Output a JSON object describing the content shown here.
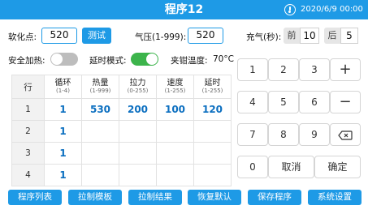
{
  "header": {
    "title": "程序12",
    "datetime": "2020/6/9  00:00",
    "icon": "thermometer-icon"
  },
  "params": {
    "softening_label": "软化点:",
    "softening_value": "520",
    "test_button": "测试",
    "pressure_label": "气压(1-999):",
    "pressure_value": "520",
    "inflate_label": "充气(秒):",
    "inflate_front_label": "前",
    "inflate_front_value": "10",
    "inflate_back_label": "后",
    "inflate_back_value": "5"
  },
  "options": {
    "safety_heat_label": "安全加热:",
    "safety_heat_on": false,
    "delay_mode_label": "延时模式:",
    "delay_mode_on": true,
    "clamp_temp_label": "夹钳温度:",
    "clamp_temp_value": "70°C"
  },
  "table": {
    "row_header": "行",
    "columns": [
      {
        "name": "循环",
        "range": "(1-4)"
      },
      {
        "name": "热量",
        "range": "(1-999)"
      },
      {
        "name": "拉力",
        "range": "(0-255)"
      },
      {
        "name": "速度",
        "range": "(1-255)"
      },
      {
        "name": "延时",
        "range": "(1-255)"
      }
    ],
    "rows": [
      {
        "index": "1",
        "cells": [
          "1",
          "530",
          "200",
          "100",
          "120"
        ]
      },
      {
        "index": "2",
        "cells": [
          "1",
          "",
          "",
          "",
          ""
        ]
      },
      {
        "index": "3",
        "cells": [
          "1",
          "",
          "",
          "",
          ""
        ]
      },
      {
        "index": "4",
        "cells": [
          "1",
          "",
          "",
          "",
          ""
        ]
      }
    ]
  },
  "keypad": {
    "keys": [
      "1",
      "2",
      "3",
      "+",
      "4",
      "5",
      "6",
      "−",
      "7",
      "8",
      "9",
      "⌫",
      "0",
      "取消",
      "确定"
    ],
    "backspace_icon": "backspace-icon"
  },
  "footer": {
    "buttons": [
      "程序列表",
      "拉制模板",
      "拉制结果",
      "恢复默认",
      "保存程序",
      "系统设置"
    ]
  },
  "colors": {
    "accent": "#1e9ae6",
    "toggle_on": "#3cb44b",
    "toggle_off": "#bdbdbd"
  }
}
